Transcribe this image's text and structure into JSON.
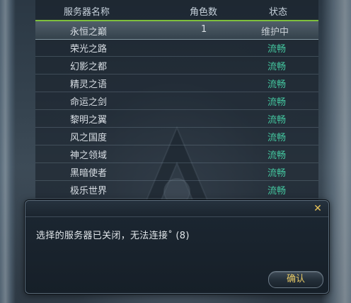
{
  "server_list": {
    "headers": {
      "name": "服务器名称",
      "count": "角色数",
      "status": "状态"
    },
    "rows": [
      {
        "name": "永恒之巅",
        "count": "1",
        "status": "维护中",
        "selected": true
      },
      {
        "name": "荣光之路",
        "count": "",
        "status": "流畅"
      },
      {
        "name": "幻影之都",
        "count": "",
        "status": "流畅"
      },
      {
        "name": "精灵之语",
        "count": "",
        "status": "流畅"
      },
      {
        "name": "命运之剑",
        "count": "",
        "status": "流畅"
      },
      {
        "name": "黎明之翼",
        "count": "",
        "status": "流畅"
      },
      {
        "name": "风之国度",
        "count": "",
        "status": "流畅"
      },
      {
        "name": "神之领域",
        "count": "",
        "status": "流畅"
      },
      {
        "name": "黑暗使者",
        "count": "",
        "status": "流畅"
      },
      {
        "name": "极乐世界",
        "count": "",
        "status": "流畅"
      }
    ]
  },
  "dialog": {
    "message": "选择的服务器已关闭，无法连接˚ (8)",
    "confirm_label": "确认",
    "close_icon": "close-icon"
  },
  "colors": {
    "status_ok": "#44c8a0",
    "selected_accent": "#7dbf3c",
    "button_text": "#e6c865"
  }
}
